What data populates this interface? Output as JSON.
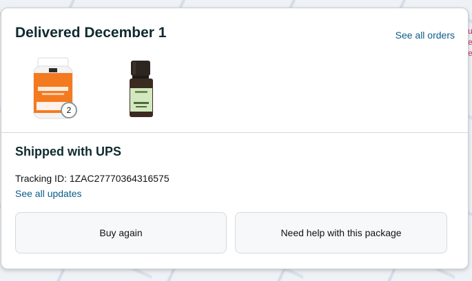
{
  "delivery": {
    "title": "Delivered December 1",
    "see_all_orders_label": "See all orders",
    "items": [
      {
        "icon": "supplement-bottle-icon",
        "quantity": "2",
        "colors": [
          "#f47a20",
          "#ffffff"
        ]
      },
      {
        "icon": "essential-oil-bottle-icon",
        "colors": [
          "#3a2a1e",
          "#cfe6b8"
        ]
      }
    ]
  },
  "shipment": {
    "carrier": "Shipped with UPS",
    "tracking_label": "Tracking ID: 1ZAC27770364316575",
    "see_updates_label": "See all updates"
  },
  "actions": {
    "buy_again_label": "Buy again",
    "help_label": "Need help with this package"
  },
  "colors": {
    "link": "#0a5c8a",
    "heading": "#0f2a2e",
    "card_border": "#c9ccd1"
  }
}
